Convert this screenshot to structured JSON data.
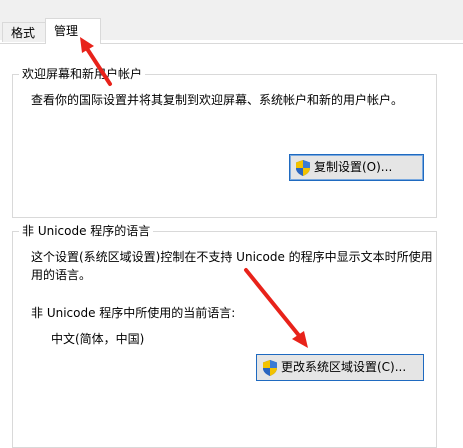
{
  "tabs": [
    {
      "label": "格式"
    },
    {
      "label": "管理"
    }
  ],
  "welcome": {
    "legend": "欢迎屏幕和新用户帐户",
    "description": "查看你的国际设置并将其复制到欢迎屏幕、系统帐户和新的用户帐户。",
    "copy_button": "复制设置(O)..."
  },
  "non_unicode": {
    "legend": "非 Unicode 程序的语言",
    "description_line1": "这个设置(系统区域设置)控制在不支持 Unicode 的程序中显示文本时所使用",
    "description_line2": "用的语言。",
    "current_label": "非 Unicode 程序中所使用的当前语言:",
    "current_value": "中文(简体，中国)",
    "change_button": "更改系统区域设置(C)..."
  },
  "colors": {
    "annotation_arrow": "#e8221a",
    "button_border": "#1f6ac0"
  }
}
